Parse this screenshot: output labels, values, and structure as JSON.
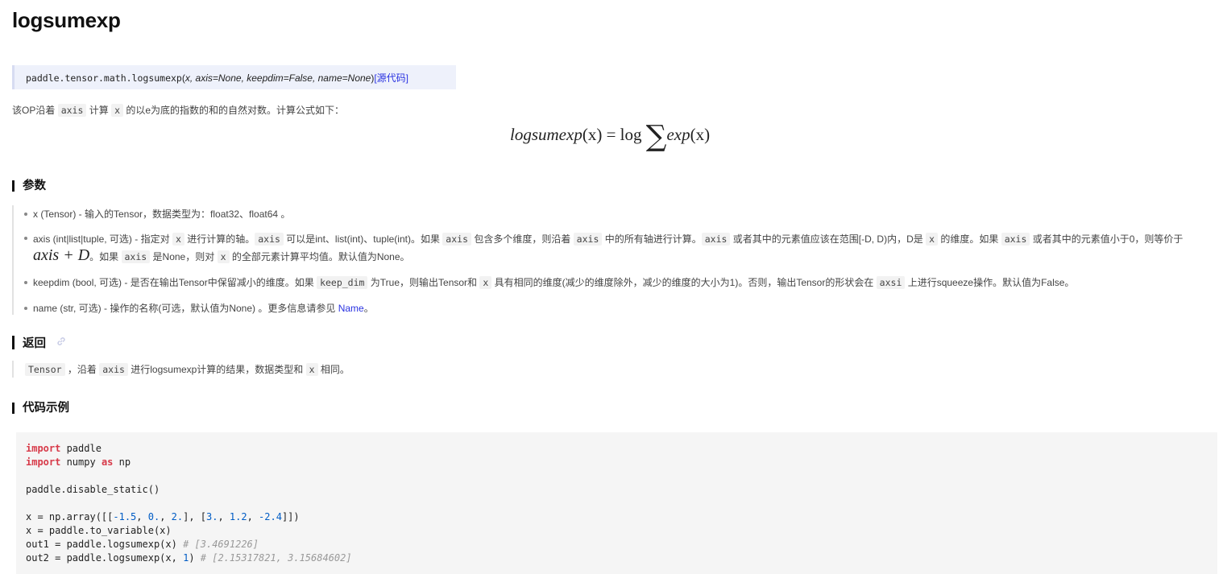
{
  "page": {
    "title": "logsumexp"
  },
  "signature": {
    "path": "paddle.tensor.math.logsumexp",
    "open": "(",
    "args": "x, axis=None, keepdim=False, name=None",
    "close": ")",
    "source_link": "[源代码]"
  },
  "description": {
    "t1": "该OP沿着 ",
    "c1": "axis",
    "t2": " 计算 ",
    "c2": "x",
    "t3": " 的以e为底的指数的和的自然对数。计算公式如下："
  },
  "formula": {
    "lhs": "logsumexp",
    "lhs_arg": "(x)",
    "eq": " = log ",
    "sum": "∑",
    "rhs": "exp",
    "rhs_arg": "(x)"
  },
  "params": {
    "heading": "参数",
    "x": {
      "text": "x (Tensor) - 输入的Tensor，数据类型为：float32、float64 。"
    },
    "axis": {
      "t1": "axis (int|list|tuple, 可选) - 指定对 ",
      "c1": "x",
      "t2": " 进行计算的轴。",
      "c2": "axis",
      "t3": " 可以是int、list(int)、tuple(int)。如果 ",
      "c3": "axis",
      "t4": " 包含多个维度，则沿着 ",
      "c4": "axis",
      "t5": " 中的所有轴进行计算。",
      "c5": "axis",
      "t6": " 或者其中的元素值应该在范围[-D, D)内，D是 ",
      "c6": "x",
      "t7": " 的维度。如果 ",
      "c7": "axis",
      "t8": " 或者其中的元素值小于0，则等价于",
      "math": "axis + D",
      "t9": "。如果 ",
      "c8": "axis",
      "t10": " 是None，则对 ",
      "c9": "x",
      "t11": " 的全部元素计算平均值。默认值为None。"
    },
    "keepdim": {
      "t1": "keepdim (bool, 可选) - 是否在输出Tensor中保留减小的维度。如果 ",
      "c1": "keep_dim",
      "t2": " 为True，则输出Tensor和 ",
      "c2": "x",
      "t3": " 具有相同的维度(减少的维度除外，减少的维度的大小为1)。否则，输出Tensor的形状会在 ",
      "c3": "axsi",
      "t4": " 上进行squeeze操作。默认值为False。"
    },
    "name": {
      "t1": "name (str, 可选) - 操作的名称(可选，默认值为None) 。更多信息请参见 ",
      "link": "Name",
      "t2": "。"
    }
  },
  "returns": {
    "heading": "返回",
    "c1": "Tensor",
    "t1": " ，沿着 ",
    "c2": "axis",
    "t2": " 进行logsumexp计算的结果，数据类型和 ",
    "c3": "x",
    "t3": " 相同。"
  },
  "example": {
    "heading": "代码示例",
    "l1_kw": "import",
    "l1_rest": " paddle",
    "l2_kw": "import",
    "l2_mid": " numpy ",
    "l2_kw2": "as",
    "l2_rest": " np",
    "l3": "paddle.disable_static()",
    "l4_a": "x = np.array([[",
    "l4_n1": "-1.5",
    "l4_n2": "0.",
    "l4_n3": "2.",
    "l4_n4": "3.",
    "l4_n5": "1.2",
    "l4_n6": "-2.4",
    "l5": "x = paddle.to_variable(x)",
    "l6_code": "out1 = paddle.logsumexp(x) ",
    "l6_cmt": "# [3.4691226]",
    "l7_code": "out2 = paddle.logsumexp(x, ",
    "l7_num": "1",
    "l7_close": ") ",
    "l7_cmt": "# [2.15317821, 3.15684602]"
  }
}
